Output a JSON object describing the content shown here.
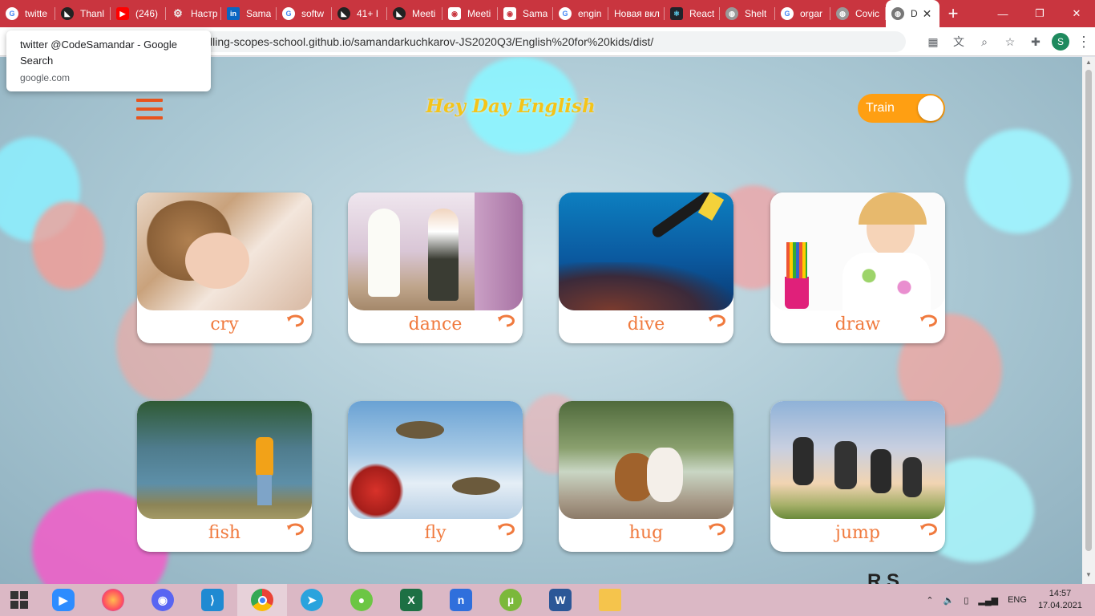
{
  "browser": {
    "tabs": [
      {
        "title": "twitte",
        "favicon": "google-icon"
      },
      {
        "title": "Thanl",
        "favicon": "rss-icon"
      },
      {
        "title": "(246)",
        "favicon": "youtube-icon"
      },
      {
        "title": "Настр",
        "favicon": "gear-icon"
      },
      {
        "title": "Sama",
        "favicon": "linkedin-icon"
      },
      {
        "title": "softw",
        "favicon": "google-icon"
      },
      {
        "title": "41+ I",
        "favicon": "rss-icon"
      },
      {
        "title": "Meeti",
        "favicon": "rss-icon"
      },
      {
        "title": "Meeti",
        "favicon": "camera-icon"
      },
      {
        "title": "Sama",
        "favicon": "camera-icon"
      },
      {
        "title": "engin",
        "favicon": "google-icon"
      },
      {
        "title": "Новая вкл",
        "favicon": "none"
      },
      {
        "title": "React",
        "favicon": "react-icon"
      },
      {
        "title": "Shelt",
        "favicon": "globe-icon"
      },
      {
        "title": "orgar",
        "favicon": "google-icon"
      },
      {
        "title": "Covic",
        "favicon": "globe-icon"
      },
      {
        "title": "D",
        "favicon": "globe-icon",
        "active": true
      }
    ],
    "new_tab_label": "+",
    "url": "lling-scopes-school.github.io/samandarkuchkarov-JS2020Q3/English%20for%20kids/dist/",
    "profile_initial": "S",
    "tooltip": {
      "title": "twitter @CodeSamandar - Google Search",
      "url": "google.com"
    }
  },
  "page": {
    "logo": "Hey Day English",
    "mode_toggle": {
      "label": "Train",
      "checked": true
    },
    "cards": [
      {
        "word": "cry"
      },
      {
        "word": "dance"
      },
      {
        "word": "dive"
      },
      {
        "word": "draw"
      },
      {
        "word": "fish"
      },
      {
        "word": "fly"
      },
      {
        "word": "hug"
      },
      {
        "word": "jump"
      }
    ],
    "footer_partial": "R   S"
  },
  "taskbar": {
    "apps": [
      "windows-start",
      "zoom",
      "firefox",
      "discord",
      "vscode",
      "chrome",
      "telegram",
      "wechat",
      "excel",
      "nimbus",
      "utorrent",
      "word",
      "file-explorer"
    ],
    "language": "ENG",
    "time": "14:57",
    "date": "17.04.2021"
  },
  "colors": {
    "tab_strip": "#c9353f",
    "burger": "#e8541d",
    "logo": "#f4c419",
    "toggle": "#ff9f12",
    "card_word": "#f07a3e"
  }
}
